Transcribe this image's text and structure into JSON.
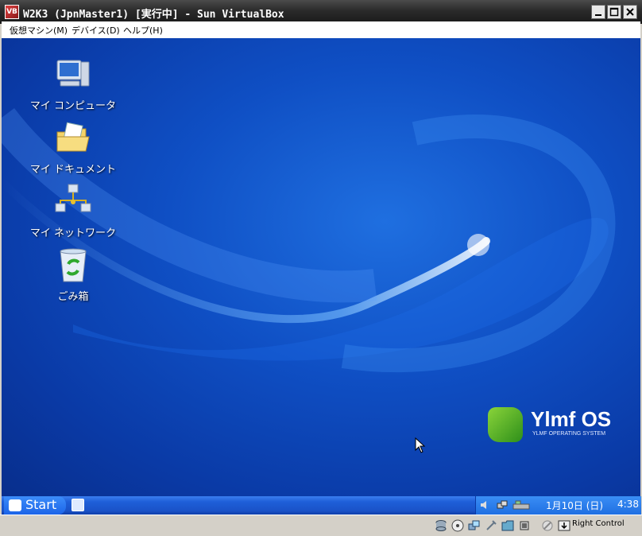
{
  "window": {
    "title": "W2K3 (JpnMaster1) [実行中] - Sun VirtualBox",
    "app_icon_text": "VB"
  },
  "menubar": {
    "items": [
      "仮想マシン(M)",
      "デバイス(D)",
      "ヘルプ(H)"
    ]
  },
  "desktop": {
    "icons": [
      {
        "label": "マイ コンピュータ",
        "icon": "my-computer-icon"
      },
      {
        "label": "マイ ドキュメント",
        "icon": "my-documents-icon"
      },
      {
        "label": "マイ ネットワーク",
        "icon": "my-network-icon"
      },
      {
        "label": "ごみ箱",
        "icon": "recycle-bin-icon"
      }
    ],
    "logo": {
      "name": "Ylmf OS",
      "subtitle": "YLMF OPERATING SYSTEM"
    }
  },
  "taskbar": {
    "start_label": "Start",
    "clock_date": "1月10日 (日)",
    "clock_time": "4:38"
  },
  "statusbar": {
    "host_key": "Right Control"
  },
  "colors": {
    "desktop": "#0f4fc4",
    "taskbar": "#1e5fd8",
    "titlebar": "#2a2a2a"
  }
}
